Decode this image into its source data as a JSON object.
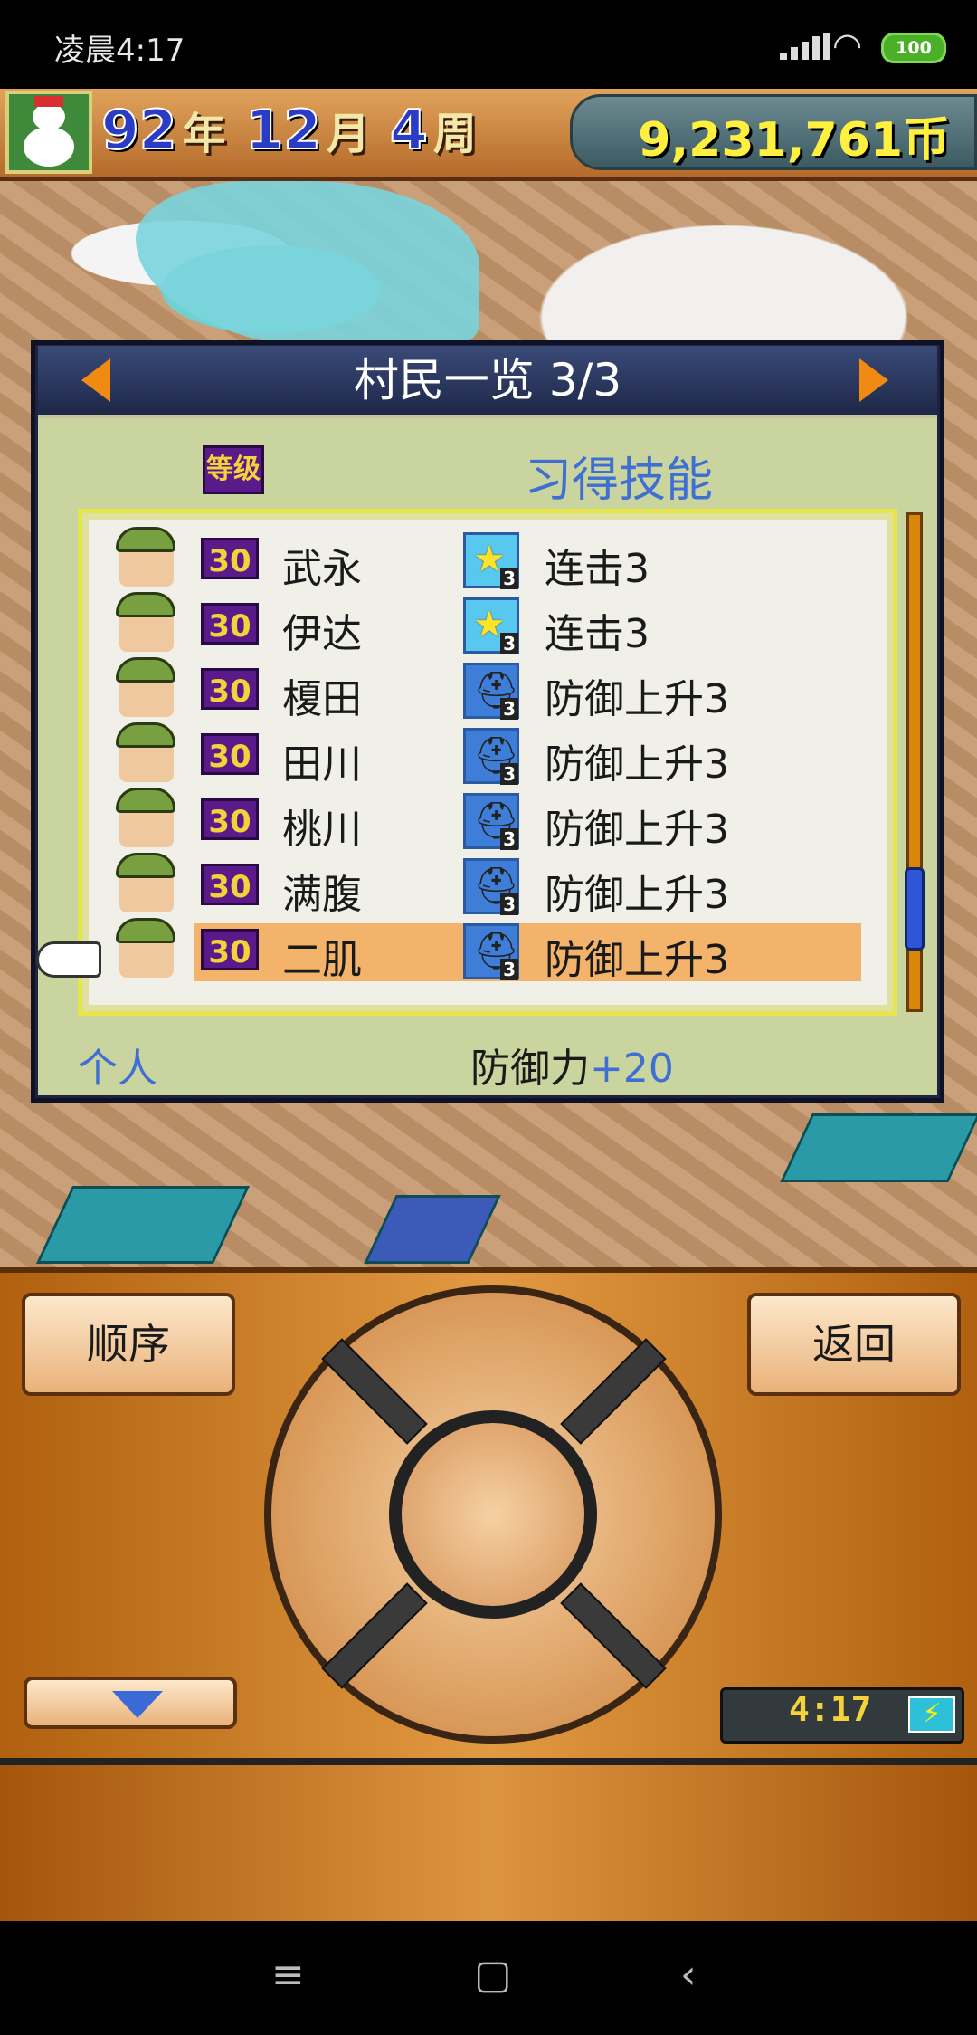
{
  "status_bar": {
    "time": "凌晨4:17",
    "battery": "100"
  },
  "game_header": {
    "year": "92",
    "year_unit": "年",
    "month": "12",
    "month_unit": "月",
    "week": "4",
    "week_unit": "周",
    "coins": "9,231,761币"
  },
  "dialog": {
    "title": "村民一览 3/3",
    "column_level": "等级",
    "column_skill": "习得技能",
    "rows": [
      {
        "level": "30",
        "name": "武永",
        "skill_icon": "star-icon",
        "skill": "连击3"
      },
      {
        "level": "30",
        "name": "伊达",
        "skill_icon": "star-icon",
        "skill": "连击3"
      },
      {
        "level": "30",
        "name": "榎田",
        "skill_icon": "helmet-icon",
        "skill": "防御上升3"
      },
      {
        "level": "30",
        "name": "田川",
        "skill_icon": "helmet-icon",
        "skill": "防御上升3"
      },
      {
        "level": "30",
        "name": "桃川",
        "skill_icon": "helmet-icon",
        "skill": "防御上升3"
      },
      {
        "level": "30",
        "name": "满腹",
        "skill_icon": "helmet-icon",
        "skill": "防御上升3"
      },
      {
        "level": "30",
        "name": "二肌",
        "skill_icon": "helmet-icon",
        "skill": "防御上升3"
      }
    ],
    "selected_index": 6,
    "footer_left": "个人",
    "footer_stat_label": "防御力",
    "footer_stat_value": "+20"
  },
  "controls": {
    "order_button": "顺序",
    "back_button": "返回",
    "clock": "4:17"
  },
  "colors": {
    "highlight": "#f3b36a",
    "accent_blue": "#3f6fd2",
    "level_badge": "#5a1a8a"
  }
}
